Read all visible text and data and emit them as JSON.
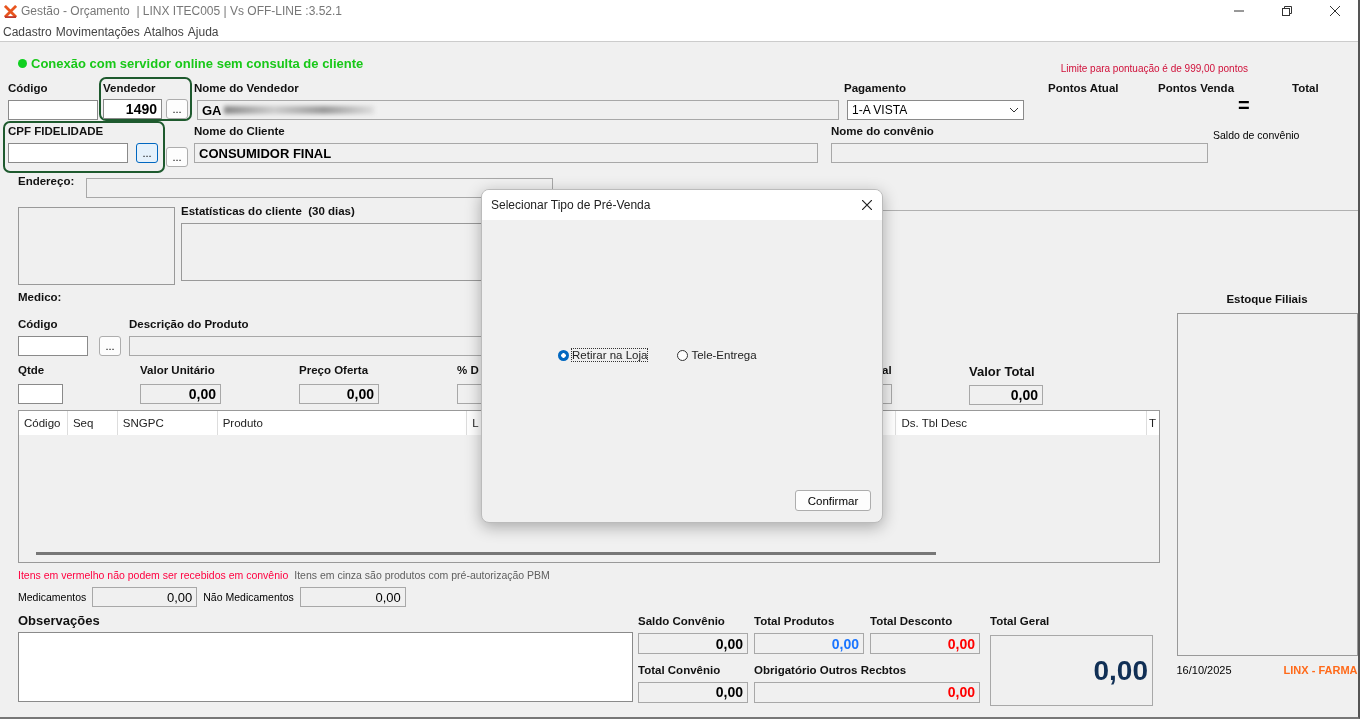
{
  "window": {
    "title": "Gestão - Orçamento  | LINX ITEC005 | Vs OFF-LINE :3.52.1"
  },
  "menu": [
    "Cadastro",
    "Movimentações",
    "Atalhos",
    "Ajuda"
  ],
  "connection_status": {
    "text": "Conexão com servidor online sem consulta de cliente",
    "online": true
  },
  "points_limit": "Limite para pontuação é de 999,00 pontos",
  "header": {
    "codigo_label": "Código",
    "vendedor_label": "Vendedor",
    "vendedor_value": "1490",
    "vendedor_lookup": "...",
    "nome_vendedor_label": "Nome do Vendedor",
    "nome_vendedor_value": "GA",
    "pagamento_label": "Pagamento",
    "pagamento_value": "1-A VISTA",
    "pontos_atual_label": "Pontos Atual",
    "pontos_venda_label": "Pontos Venda",
    "total_label": "Total",
    "equals": "=",
    "cpf_label": "CPF FIDELIDADE",
    "cpf_lookup": {
      "text": "...",
      "focused": true
    },
    "cliente_lookup": "...",
    "nome_cliente_label": "Nome do Cliente",
    "nome_cliente_value": "CONSUMIDOR FINAL",
    "convenio_label": "Nome do convênio",
    "saldo_convenio_label": "Saldo de convênio",
    "endereco_label": "Endereço:",
    "estatisticas_label": "Estatísticas do cliente  (30 dias)"
  },
  "product": {
    "medico_label": "Medico:",
    "codigo_label": "Código",
    "lookup": "...",
    "descricao_label": "Descrição do Produto",
    "qtde_label": "Qtde",
    "valor_unitario_label": "Valor Unitário",
    "valor_unitario_value": "0,00",
    "preco_oferta_label": "Preço Oferta",
    "preco_oferta_value": "0,00",
    "desconto_label": "% D",
    "column_6_label": "al",
    "valor_total_label": "Valor Total",
    "valor_total_value": "0,00"
  },
  "estoque_label": "Estoque Filiais",
  "table": {
    "columns": [
      "Código",
      "Seq",
      "SNGPC",
      "Produto",
      "L",
      "Ds. Tbl Desc",
      "T"
    ]
  },
  "notes": [
    {
      "text": "Itens em vermelho não podem ser recebidos em convênio",
      "color": "#ff0040"
    },
    {
      "text": "Itens em cinza são produtos com pré-autorização PBM",
      "color": "#606060"
    }
  ],
  "subtotals": {
    "medicamentos_label": "Medicamentos",
    "medicamentos_value": "0,00",
    "nao_medicamentos_label": "Não Medicamentos",
    "nao_medicamentos_value": "0,00"
  },
  "observacoes_label": "Observações",
  "totals": [
    {
      "label": "Saldo Convênio",
      "value": "0,00",
      "color": "#000000"
    },
    {
      "label": "Total Produtos",
      "value": "0,00",
      "color": "#1a75ff"
    },
    {
      "label": "Total Desconto",
      "value": "0,00",
      "color": "#ff0000"
    },
    {
      "label": "Total Convênio",
      "value": "0,00",
      "color": "#000000"
    },
    {
      "label": "Obrigatório Outros Recbtos",
      "value": "0,00",
      "color": "#ff0000"
    }
  ],
  "total_geral": {
    "label": "Total Geral",
    "value": "0,00"
  },
  "footer": {
    "date": "16/10/2025",
    "brand": "LINX - FARMA"
  },
  "dialog": {
    "title": "Selecionar Tipo de Pré-Venda",
    "options": [
      {
        "label": "Retirar na Loja",
        "selected": true
      },
      {
        "label": "Tele-Entrega",
        "selected": false
      }
    ],
    "confirm": "Confirmar"
  }
}
